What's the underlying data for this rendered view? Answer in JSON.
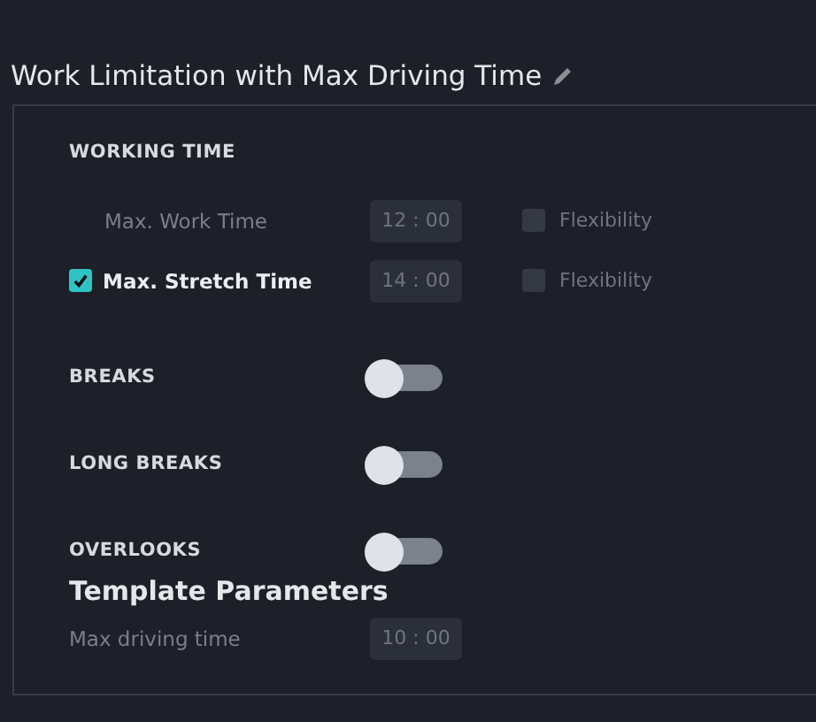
{
  "title": "Work Limitation with Max Driving Time",
  "working_time": {
    "heading": "WORKING TIME",
    "rows": [
      {
        "kind": "plain",
        "label": "Max. Work Time",
        "value": "12 : 00",
        "flexibility": {
          "label": "Flexibility",
          "checked": false
        }
      },
      {
        "kind": "checkbox",
        "label": "Max. Stretch Time",
        "checked": true,
        "value": "14 : 00",
        "flexibility": {
          "label": "Flexibility",
          "checked": false
        }
      }
    ]
  },
  "toggles": [
    {
      "label": "BREAKS",
      "on": false
    },
    {
      "label": "LONG BREAKS",
      "on": false
    },
    {
      "label": "OVERLOOKS",
      "on": false
    }
  ],
  "template": {
    "heading": "Template Parameters",
    "params": [
      {
        "label": "Max driving time",
        "value": "10 : 00"
      }
    ]
  }
}
